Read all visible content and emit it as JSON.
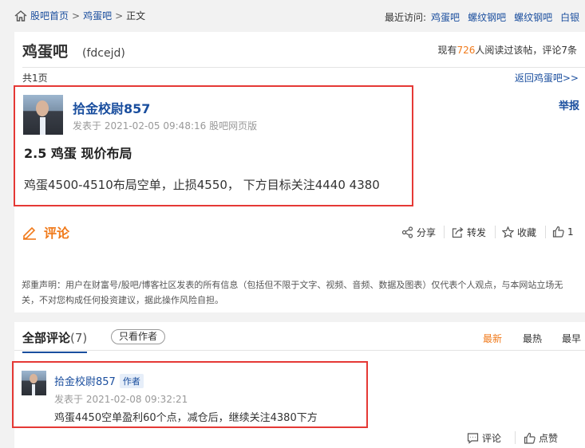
{
  "breadcrumb": {
    "home": "股吧首页",
    "bar": "鸡蛋吧",
    "current": "正文",
    "sep": ">"
  },
  "recent": {
    "label": "最近访问:",
    "items": [
      "鸡蛋吧",
      "螺纹钢吧",
      "螺纹钢吧",
      "白银"
    ]
  },
  "header": {
    "bar_name": "鸡蛋吧",
    "bar_code": "(fdcejd)",
    "readers_prefix": "现有",
    "readers_count": "726",
    "readers_suffix": "人阅读过该帖，评论7条",
    "pages": "共1页",
    "back_link": "返回鸡蛋吧>>"
  },
  "post": {
    "author": "拾金校尉857",
    "meta": "发表于 2021-02-05 09:48:16 股吧网页版",
    "title": "2.5 鸡蛋 现价布局",
    "body": "鸡蛋4500-4510布局空单，止损4550， 下方目标关注4440 4380",
    "report": "举报"
  },
  "comment_heading": "评论",
  "actions": {
    "share": "分享",
    "repost": "转发",
    "favorite": "收藏",
    "like_count": "1"
  },
  "disclaimer": "郑重声明：用户在财富号/股吧/博客社区发表的所有信息（包括但不限于文字、视频、音频、数据及图表）仅代表个人观点，与本网站立场无关，不对您构成任何投资建议，据此操作风险自担。",
  "comments_section": {
    "tab_label": "全部评论",
    "tab_count": "(7)",
    "only_author": "只看作者",
    "sort": [
      "最新",
      "最热",
      "最早"
    ]
  },
  "comments": [
    {
      "author": "拾金校尉857",
      "badge": "作者",
      "meta": "发表于 2021-02-08 09:32:21",
      "text": "鸡蛋4450空单盈利60个点，减仓后，继续关注4380下方",
      "reply_label": "评论",
      "like_label": "点赞"
    }
  ],
  "colors": {
    "accent_orange": "#f07a1b",
    "link_blue": "#1a4e9e",
    "highlight_red": "#e53935"
  }
}
